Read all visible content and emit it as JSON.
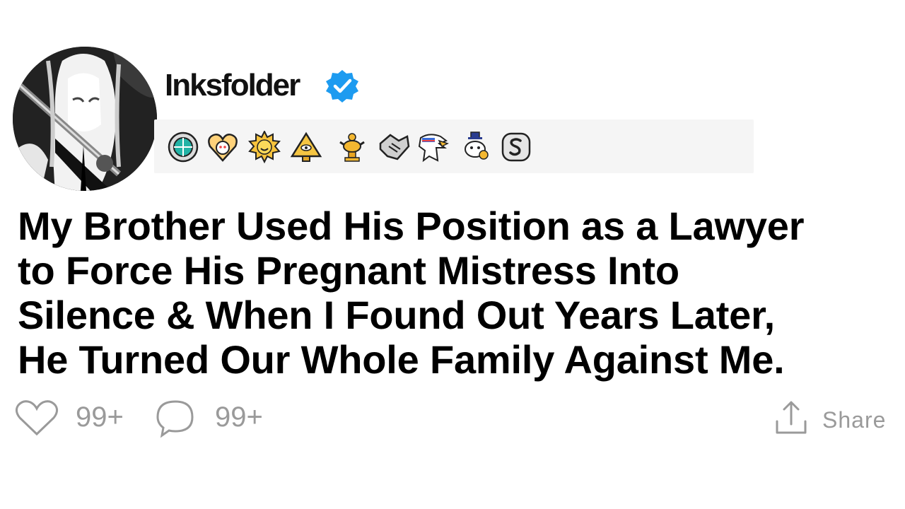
{
  "post": {
    "username": "Inksfolder",
    "verified": true,
    "title_lines": [
      "My Brother Used His Position as a Lawyer",
      "to Force His Pregnant Mistress Into",
      "Silence & When I Found Out Years Later,",
      "He Turned Our Whole Family Against Me."
    ]
  },
  "awards": [
    {
      "icon": "globe-award-icon"
    },
    {
      "icon": "wholesome-heart-award-icon"
    },
    {
      "icon": "sun-award-icon"
    },
    {
      "icon": "pyramid-eye-award-icon"
    },
    {
      "icon": "gold-trophy-award-icon"
    },
    {
      "icon": "handshake-award-icon"
    },
    {
      "icon": "eagle-award-icon"
    },
    {
      "icon": "snoo-award-icon"
    },
    {
      "icon": "silver-award-icon"
    }
  ],
  "actions": {
    "likes": "99+",
    "comments": "99+",
    "share_label": "Share"
  },
  "colors": {
    "verified_blue": "#1d9bf0",
    "muted_gray": "#9a9a9a",
    "award_bar_bg": "#f5f5f5"
  }
}
